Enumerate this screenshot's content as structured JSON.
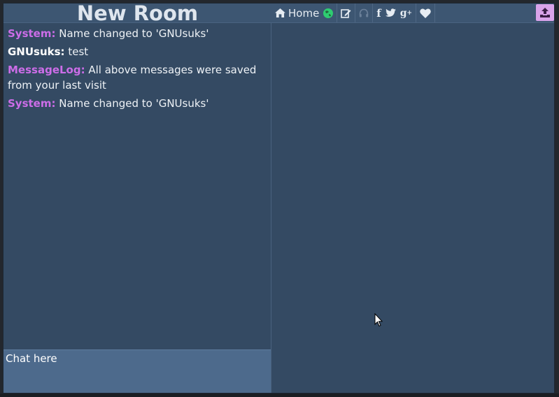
{
  "room": {
    "title": "New Room"
  },
  "messages": [
    {
      "author": "System:",
      "text": " Name changed to 'GNUsuks'",
      "type": "system"
    },
    {
      "author": "GNUsuks:",
      "text": " test",
      "type": "user"
    },
    {
      "author": "MessageLog:",
      "text": " All above messages were saved from your last visit",
      "type": "system"
    },
    {
      "author": "System:",
      "text": " Name changed to 'GNUsuks'",
      "type": "system"
    }
  ],
  "chat": {
    "value": "Chat here"
  },
  "toolbar": {
    "home_label": "Home",
    "icons": [
      "home-icon",
      "globe-icon",
      "edit-icon",
      "headphones-icon",
      "facebook-icon",
      "twitter-icon",
      "google-plus-icon",
      "heart-icon",
      "upload-icon"
    ]
  },
  "colors": {
    "background": "#344a63",
    "header": "#3d5672",
    "input": "#4d6a8c",
    "system_author": "#cc6de8",
    "upload_button": "#d9a3ea",
    "globe": "#2ecc71"
  }
}
